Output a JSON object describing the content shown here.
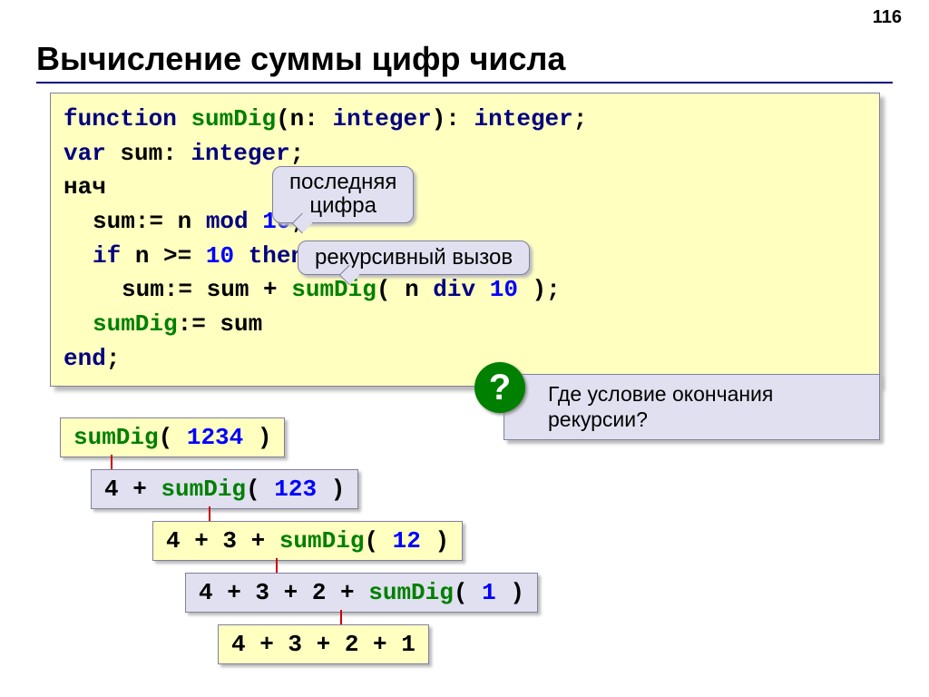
{
  "page_number": "116",
  "title": "Вычисление суммы цифр числа",
  "code": {
    "l1_kw1": "function",
    "l1_fn": "sumDig",
    "l1_mid": "(n:",
    "l1_type1": "integer",
    "l1_close": "):",
    "l1_type2": "integer",
    "l1_semi": ";",
    "l2_kw": "var",
    "l2_var": "sum:",
    "l2_type": "integer",
    "l2_semi": ";",
    "l3": "нач",
    "l4_a": "sum:= n",
    "l4_kw": "mod",
    "l4_num": "10",
    "l4_semi": ";",
    "l5_a": "if",
    "l5_b": "n >=",
    "l5_num": "10",
    "l5_then": "then",
    "l6_a": "sum:= sum +",
    "l6_fn": "sumDig",
    "l6_mid": "( n",
    "l6_kw": "div",
    "l6_num": "10",
    "l6_close": ");",
    "l7_fn": "sumDig",
    "l7_rest": ":= sum",
    "l8_kw": "end",
    "l8_semi": ";"
  },
  "callouts": {
    "c1_line1": "последняя",
    "c1_line2": "цифра",
    "c2": "рекурсивный вызов"
  },
  "question": {
    "mark": "?",
    "text_l1": "Где условие окончания",
    "text_l2": "рекурсии?"
  },
  "steps": {
    "s1_fn": "sumDig",
    "s1_open": "(",
    "s1_num": "1234",
    "s1_close": ")",
    "s2_a": "4 +",
    "s2_fn": "sumDig",
    "s2_open": "(",
    "s2_num": "123",
    "s2_close": ")",
    "s3_a": "4 + 3 +",
    "s3_fn": "sumDig",
    "s3_open": "(",
    "s3_num": "12",
    "s3_close": ")",
    "s4_a": "4 + 3 + 2 +",
    "s4_fn": "sumDig",
    "s4_open": "(",
    "s4_num": "1",
    "s4_close": ")",
    "s5": "4 + 3 + 2 + 1"
  }
}
